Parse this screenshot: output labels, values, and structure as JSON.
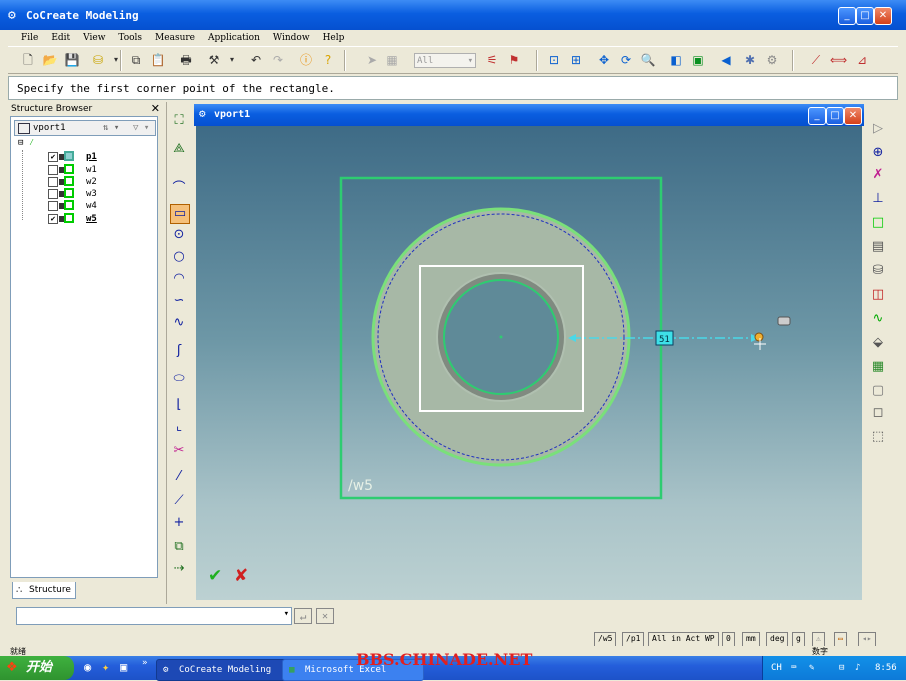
{
  "app": {
    "title": "CoCreate Modeling"
  },
  "menu": [
    "File",
    "Edit",
    "View",
    "Tools",
    "Measure",
    "Application",
    "Window",
    "Help"
  ],
  "toolbar": {
    "filter_value": "All"
  },
  "prompt": "Specify the first corner point of the rectangle.",
  "structure_browser": {
    "title": "Structure Browser",
    "root": "vport1",
    "items": [
      {
        "label": "p1",
        "checked": true
      },
      {
        "label": "w1",
        "checked": false
      },
      {
        "label": "w2",
        "checked": false
      },
      {
        "label": "w3",
        "checked": false
      },
      {
        "label": "w4",
        "checked": false
      },
      {
        "label": "w5",
        "checked": true
      }
    ],
    "tab": "Structure"
  },
  "viewport": {
    "title": "vport1",
    "workplane_label": "/w5",
    "dimension_label": "51",
    "colors": {
      "frame": "#2ecc71",
      "rect": "#ffffff",
      "ring": "#a8b8a8"
    }
  },
  "statusbar": {
    "workplane": "/w5",
    "part": "/p1",
    "filter": "All in Act WP",
    "value": "0",
    "length_unit": "mm",
    "angle_unit": "deg",
    "mass_unit": "g"
  },
  "taskbar": {
    "start": "开始",
    "tasks": [
      "CoCreate Modeling",
      "Microsoft Excel"
    ],
    "tray_lang": "CH",
    "clock": "8:56",
    "watermark": "BBS.CHINADE.NET",
    "status_left": "就绪",
    "status_right": "数字"
  }
}
